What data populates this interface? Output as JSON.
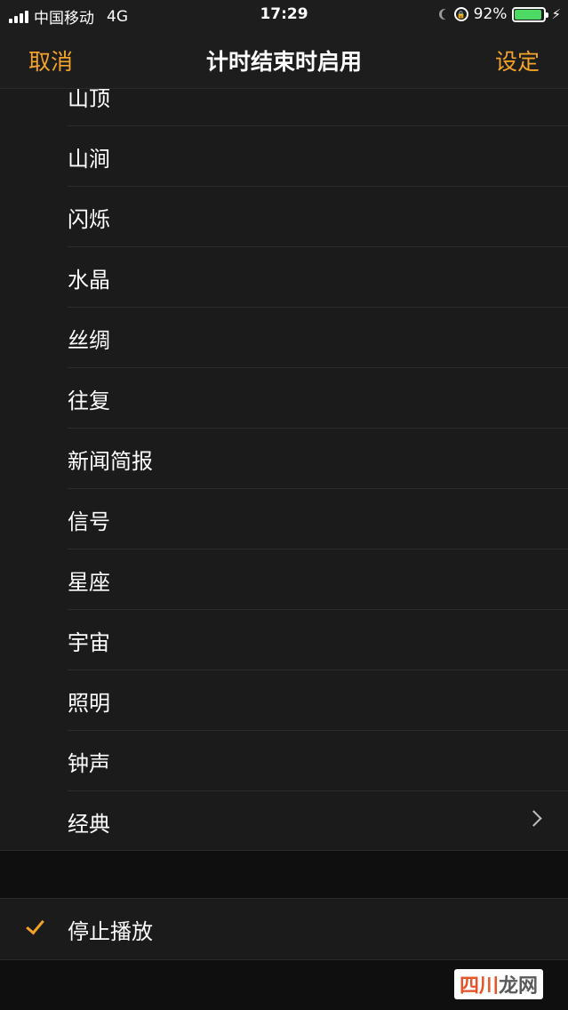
{
  "status": {
    "carrier": "中国移动",
    "network": "4G",
    "time": "17:29",
    "battery": "92%",
    "battery_level": 0.92
  },
  "nav": {
    "cancel": "取消",
    "title": "计时结束时启用",
    "set": "设定"
  },
  "sounds": [
    {
      "label": "山顶"
    },
    {
      "label": "山涧"
    },
    {
      "label": "闪烁"
    },
    {
      "label": "水晶"
    },
    {
      "label": "丝绸"
    },
    {
      "label": "往复"
    },
    {
      "label": "新闻简报"
    },
    {
      "label": "信号"
    },
    {
      "label": "星座"
    },
    {
      "label": "宇宙"
    },
    {
      "label": "照明"
    },
    {
      "label": "钟声"
    },
    {
      "label": "经典"
    }
  ],
  "stop_playing": {
    "label": "停止播放",
    "selected": true
  },
  "watermark": {
    "part1": "四川",
    "part2": "龙网"
  },
  "colors": {
    "accent": "#f4a32a",
    "battery_fill": "#4cd964"
  }
}
